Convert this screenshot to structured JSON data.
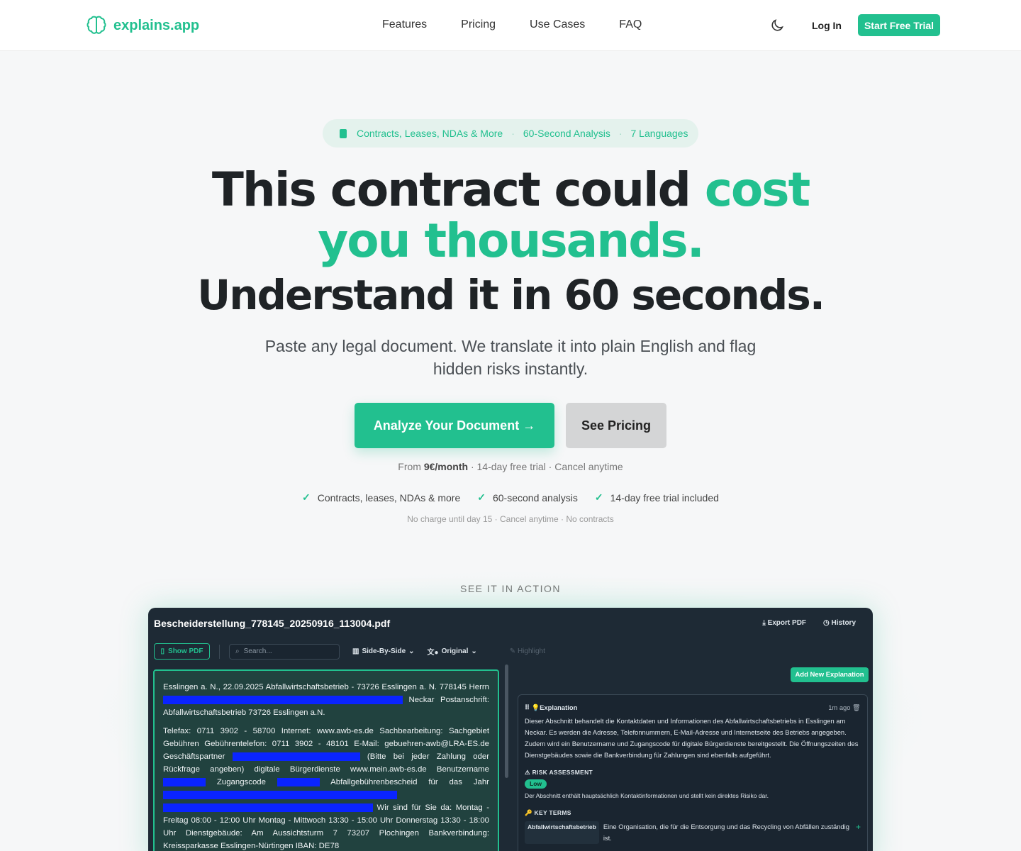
{
  "nav": {
    "brand": "explains.app",
    "links": [
      "Features",
      "Pricing",
      "Use Cases",
      "FAQ"
    ],
    "login": "Log In",
    "trial": "Start Free Trial"
  },
  "hero": {
    "pill": [
      "Contracts, Leases, NDAs & More",
      "60-Second Analysis",
      "7 Languages"
    ],
    "title_a": "This contract could ",
    "title_a_accent": "cost",
    "title_b": "you thousands.",
    "title_c": "Understand it in 60 seconds.",
    "subtitle": "Paste any legal document. We translate it into plain English and flag hidden risks instantly.",
    "cta_primary": "Analyze Your Document →",
    "cta_secondary": "See Pricing",
    "from_prefix": "From ",
    "from_price": "9€/month",
    "from_suffix": " · 14-day free trial · Cancel anytime",
    "checks": [
      "Contracts, leases, NDAs & more",
      "60-second analysis",
      "14-day free trial included"
    ],
    "fineprint": "No charge until day 15 · Cancel anytime · No contracts"
  },
  "preview": {
    "section_label": "SEE IT IN ACTION",
    "filename": "Bescheiderstellung_778145_20250916_113004.pdf",
    "export": "Export PDF",
    "history": "History",
    "show_pdf": "Show PDF",
    "search_placeholder": "Search...",
    "view_mode": "Side-By-Side",
    "language": "Original",
    "highlight": "Highlight",
    "doc_p1_a": "Esslingen a. N., 22.09.2025 Abfallwirtschaftsbetrieb - 73726 Esslingen a. N. 778145 Herrn",
    "doc_p1_b": "Neckar Postanschrift: Abfallwirtschaftsbetrieb 73726 Esslingen a.N.",
    "doc_p2_a": "Telefax: 0711 3902 - 58700 Internet: www.awb-es.de Sachbearbeitung: Sachgebiet Gebühren Gebührentelefon: 0711 3902 - 48101 E-Mail: gebuehren-awb@LRA-ES.de Geschäftspartner",
    "doc_p2_b": "(Bitte bei jeder Zahlung oder Rückfrage angeben) digitale Bürgerdienste www.mein.awb-es.de Benutzername",
    "doc_p2_c": "Zugangscode",
    "doc_p2_d": "Abfallgebührenbescheid für das Jahr",
    "doc_p2_e": "Wir sind für Sie da: Montag - Freitag 08:00 - 12:00 Uhr Montag - Mittwoch 13:30 - 15:00 Uhr Donnerstag 13:30 - 18:00 Uhr Dienstgebäude: Am Aussichtsturm 7 73207 Plochingen Bankverbindung: Kreissparkasse Esslingen-Nürtingen IBAN: DE78",
    "add_explanation": "Add New Explanation",
    "exp_title": "Explanation",
    "exp_time": "1m ago",
    "exp_body": "Dieser Abschnitt behandelt die Kontaktdaten und Informationen des Abfallwirtschaftsbetriebs in Esslingen am Neckar. Es werden die Adresse, Telefonnummern, E-Mail-Adresse und Internetseite des Betriebs angegeben. Zudem wird ein Benutzername und Zugangscode für digitale Bürgerdienste bereitgestellt. Die Öffnungszeiten des Dienstgebäudes sowie die Bankverbindung für Zahlungen sind ebenfalls aufgeführt.",
    "risk_title": "RISK ASSESSMENT",
    "risk_level": "Low",
    "risk_text": "Der Abschnitt enthält hauptsächlich Kontaktinformationen und stellt kein direktes Risiko dar.",
    "key_terms_title": "KEY TERMS",
    "term_1": "Abfallwirtschaftsbetrieb",
    "term_1_def": "Eine Organisation, die für die Entsorgung und das Recycling von Abfällen zuständig ist."
  },
  "colors": {
    "accent": "#22c08f",
    "dark": "#1e2a35"
  }
}
